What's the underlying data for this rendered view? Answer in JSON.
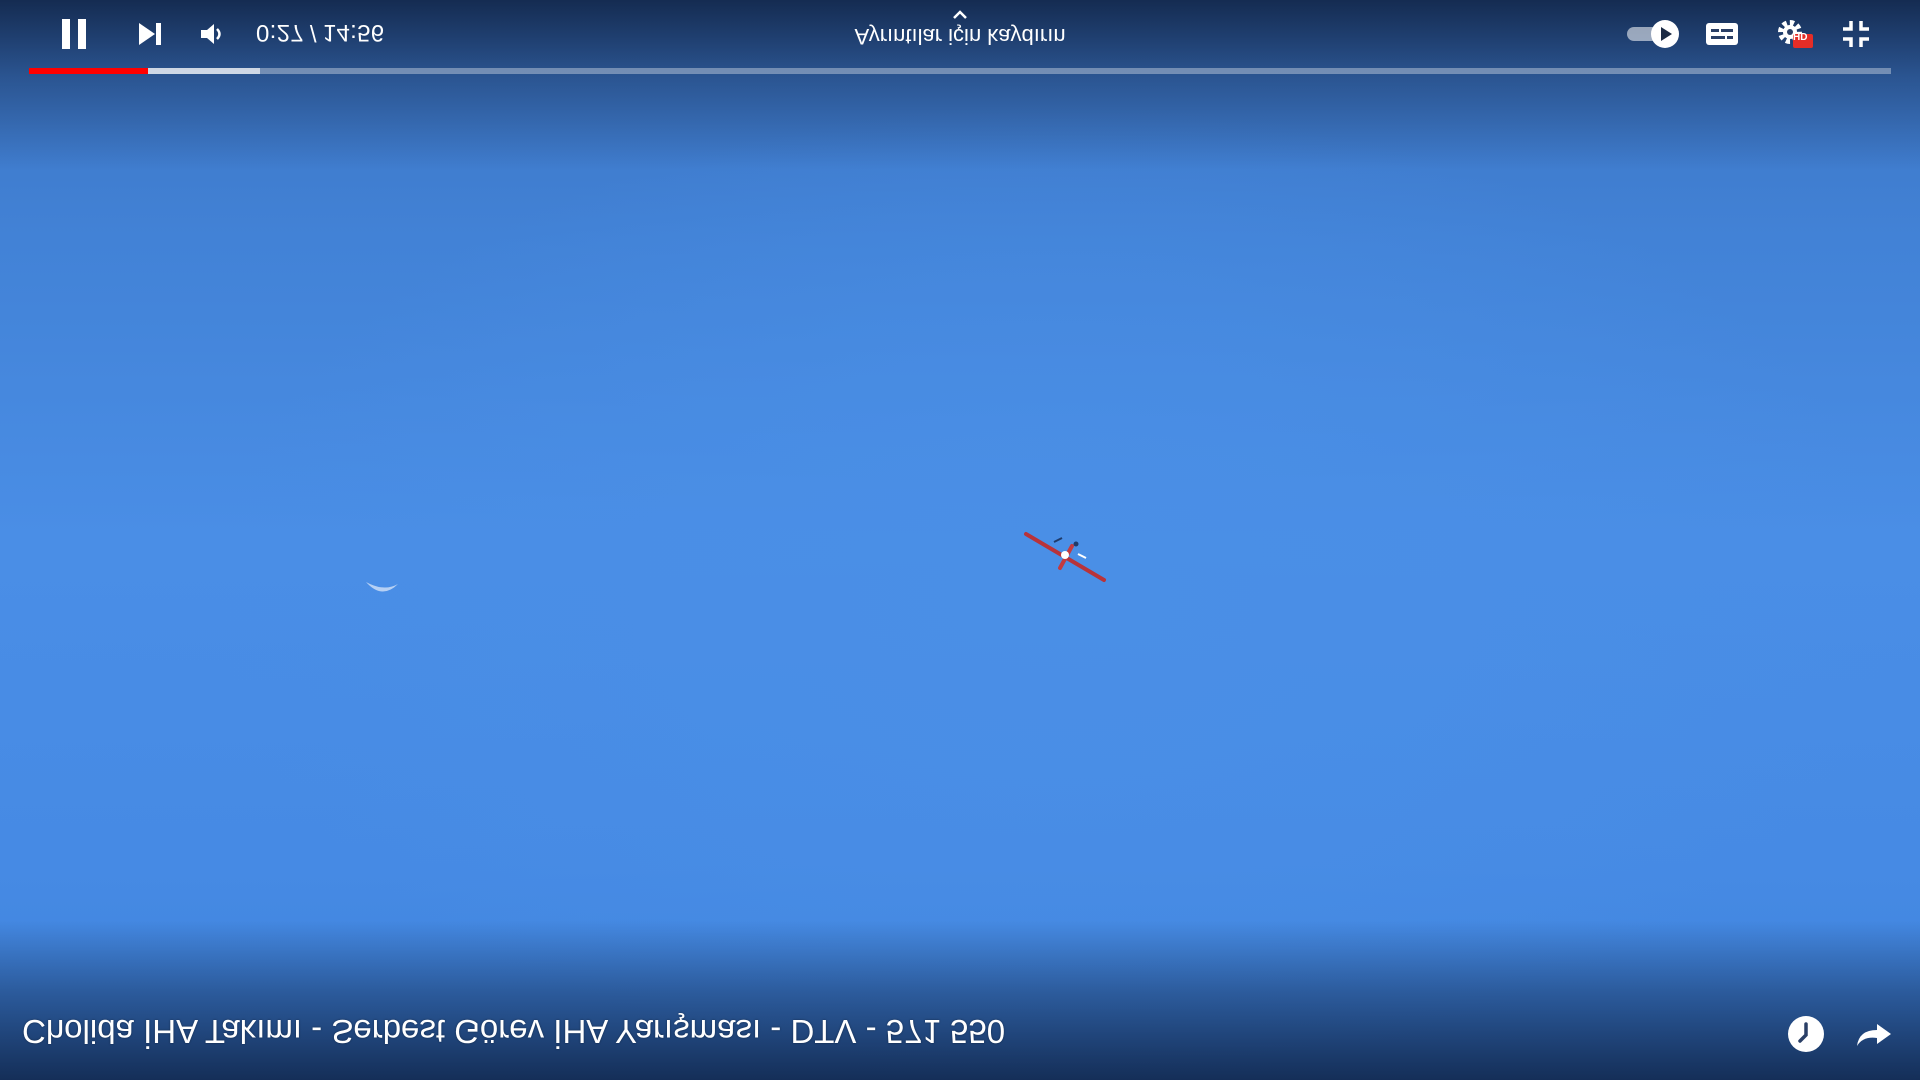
{
  "player": {
    "time": {
      "current": "0:27",
      "separator": "/",
      "duration": "14:56"
    },
    "progress": {
      "played_fraction": 0.064,
      "buffered_fraction": 0.124
    },
    "swipe_hint": "Ayrıntılar için kaydırın",
    "title": "Cholida İHA Takımı - Serbest Görev İHA Yarışması - DTV - 571 550",
    "hd_badge": "HD",
    "icons": {
      "pause": "pause-icon",
      "next": "next-icon",
      "volume": "volume-icon",
      "autoplay": "autoplay-toggle-icon",
      "captions": "captions-icon",
      "settings": "settings-gear-icon",
      "exit_fullscreen": "exit-fullscreen-icon",
      "watch_later": "clock-icon",
      "share": "share-icon",
      "swipe_up": "chevron-up-icon"
    },
    "colors": {
      "progress_played": "#ff0000",
      "hd_badge": "#e52d27"
    }
  }
}
